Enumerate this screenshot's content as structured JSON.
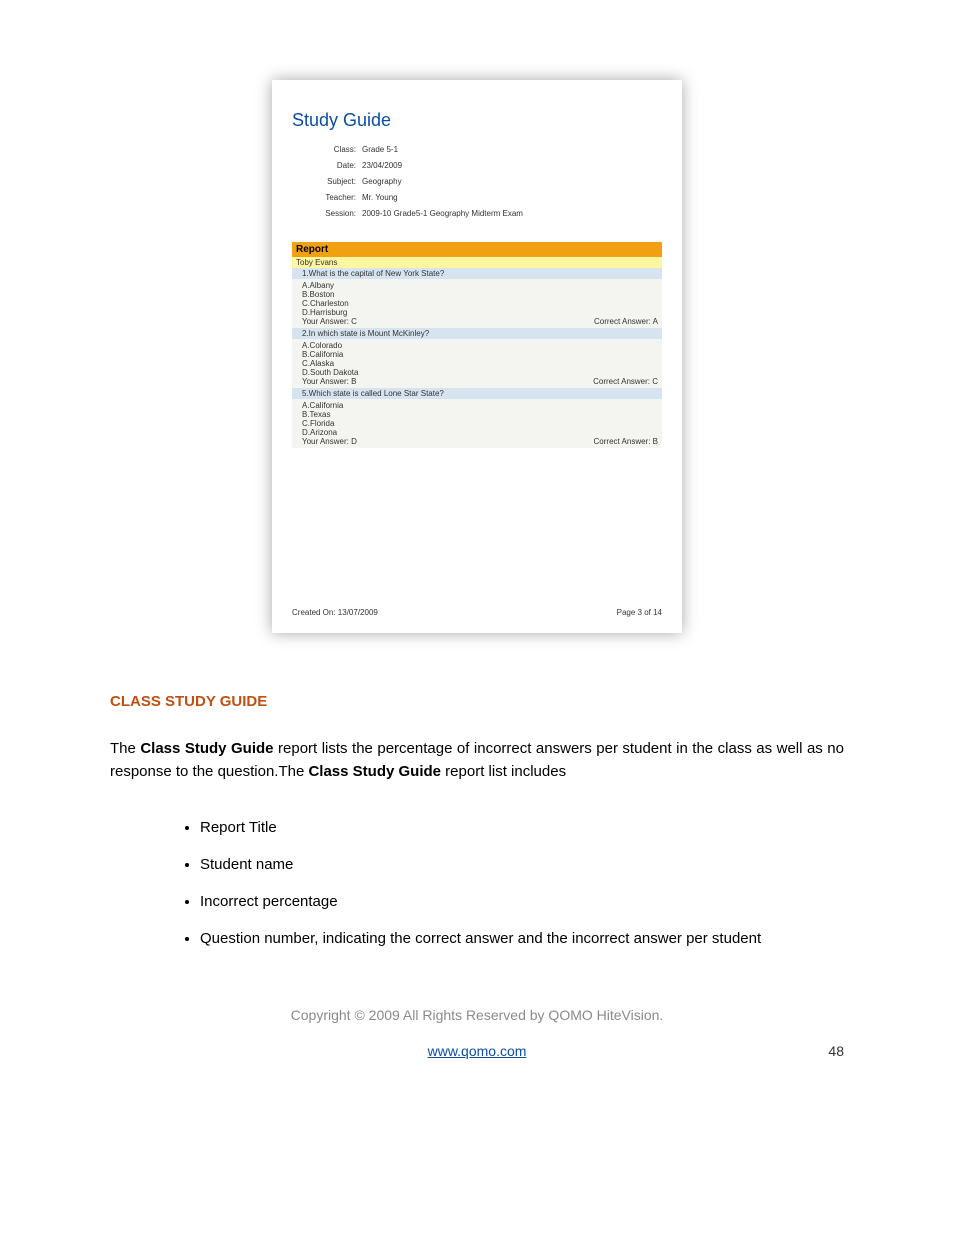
{
  "report": {
    "title": "Study Guide",
    "meta": {
      "class_label": "Class:",
      "class_value": "Grade 5-1",
      "date_label": "Date:",
      "date_value": "23/04/2009",
      "subject_label": "Subject:",
      "subject_value": "Geography",
      "teacher_label": "Teacher:",
      "teacher_value": "Mr. Young",
      "session_label": "Session:",
      "session_value": "2009-10 Grade5-1 Geography Midterm Exam"
    },
    "report_label": "Report",
    "student": "Toby Evans",
    "questions": [
      {
        "q": "1.What is the capital of New York State?",
        "a": "A.Albany",
        "b": "B.Boston",
        "c": "C.Charleston",
        "d": "D.Harrisburg",
        "your": "Your Answer: C",
        "correct": "Correct Answer: A"
      },
      {
        "q": "2.In which state is Mount McKinley?",
        "a": "A.Colorado",
        "b": "B.California",
        "c": "C.Alaska",
        "d": "D.South Dakota",
        "your": "Your Answer: B",
        "correct": "Correct Answer: C"
      },
      {
        "q": "5.Which state is called Lone Star State?",
        "a": "A.California",
        "b": "B.Texas",
        "c": "C.Florida",
        "d": "D.Arizona",
        "your": "Your Answer: D",
        "correct": "Correct Answer: B"
      }
    ],
    "created_on": "Created On: 13/07/2009",
    "page_of": "Page 3 of 14"
  },
  "section_heading": "CLASS STUDY GUIDE",
  "paragraph": {
    "p1a": "The ",
    "p1b": "Class Study Guide",
    "p1c": " report lists the percentage of incorrect answers per student in the class as well as no response to the question.The ",
    "p1d": "Class Study Guide",
    "p1e": " report list includes"
  },
  "bullets": [
    "Report Title",
    "Student name",
    "Incorrect percentage",
    "Question number, indicating the correct answer and the incorrect answer per student"
  ],
  "footer": {
    "copyright": "Copyright © 2009 All Rights Reserved by QOMO HiteVision.",
    "link": "www.qomo.com",
    "page_number": "48"
  }
}
